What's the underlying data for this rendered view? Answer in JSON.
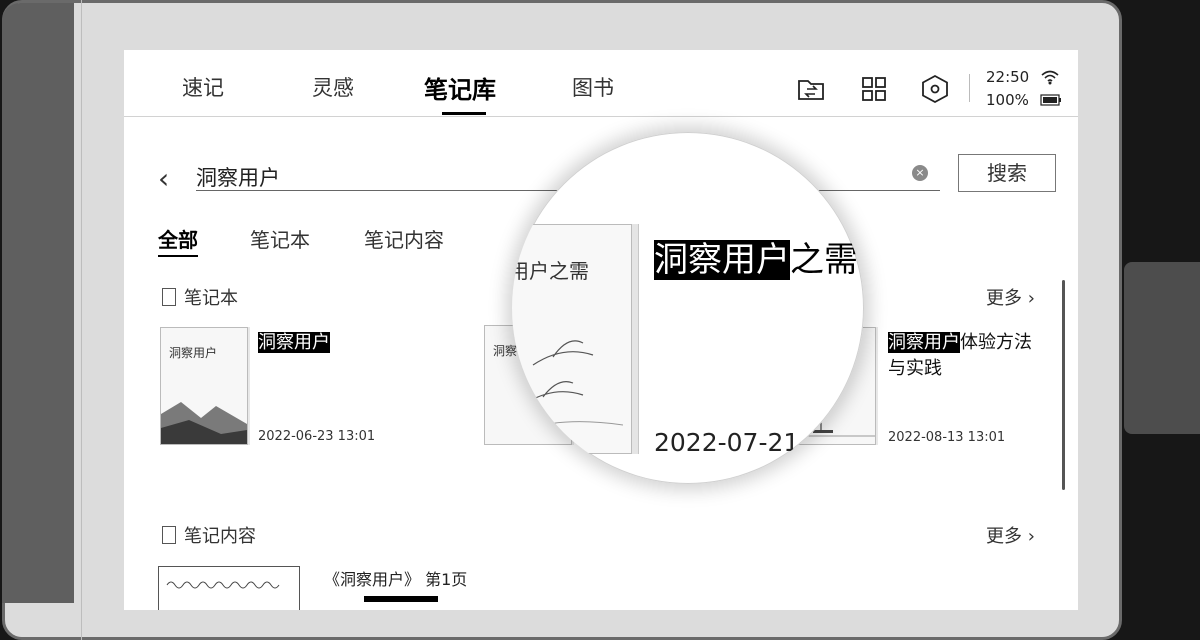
{
  "nav": {
    "tabs": [
      {
        "label": "速记"
      },
      {
        "label": "灵感"
      },
      {
        "label": "笔记库",
        "active": true
      },
      {
        "label": "图书"
      }
    ],
    "icons": [
      "folder-swap-icon",
      "grid-view-icon",
      "settings-hexagon-icon",
      "wifi-icon",
      "battery-icon"
    ],
    "time": "22:50",
    "battery": "100%"
  },
  "search": {
    "query": "洞察用户",
    "button_label": "搜索"
  },
  "filters": [
    {
      "label": "全部",
      "active": true
    },
    {
      "label": "笔记本"
    },
    {
      "label": "笔记内容"
    }
  ],
  "sections": {
    "notebooks": {
      "title": "笔记本",
      "more": "更多",
      "items": [
        {
          "cover_text": "洞察用户",
          "title_highlight": "洞察用户",
          "title_rest": "",
          "date": "2022-06-23  13:01"
        },
        {
          "cover_text": "洞察",
          "title_highlight": "洞察用户",
          "title_rest": "之需",
          "date": "2022-07-21"
        },
        {
          "cover_text": "",
          "title_highlight": "洞察用户",
          "title_rest": "体验方法与实践",
          "date": "2022-08-13  13:01"
        }
      ]
    },
    "note_content": {
      "title": "笔记内容",
      "more": "更多",
      "items": [
        {
          "title": "《洞察用户》 第1页"
        }
      ]
    }
  },
  "magnifier": {
    "book_cover_text": "用户之需",
    "title_highlight": "洞察用户",
    "title_rest": "之需",
    "date": "2022-07-21"
  },
  "colors": {
    "highlight_bg": "#000000",
    "highlight_fg": "#ffffff",
    "bezel": "#dcdcdc"
  }
}
